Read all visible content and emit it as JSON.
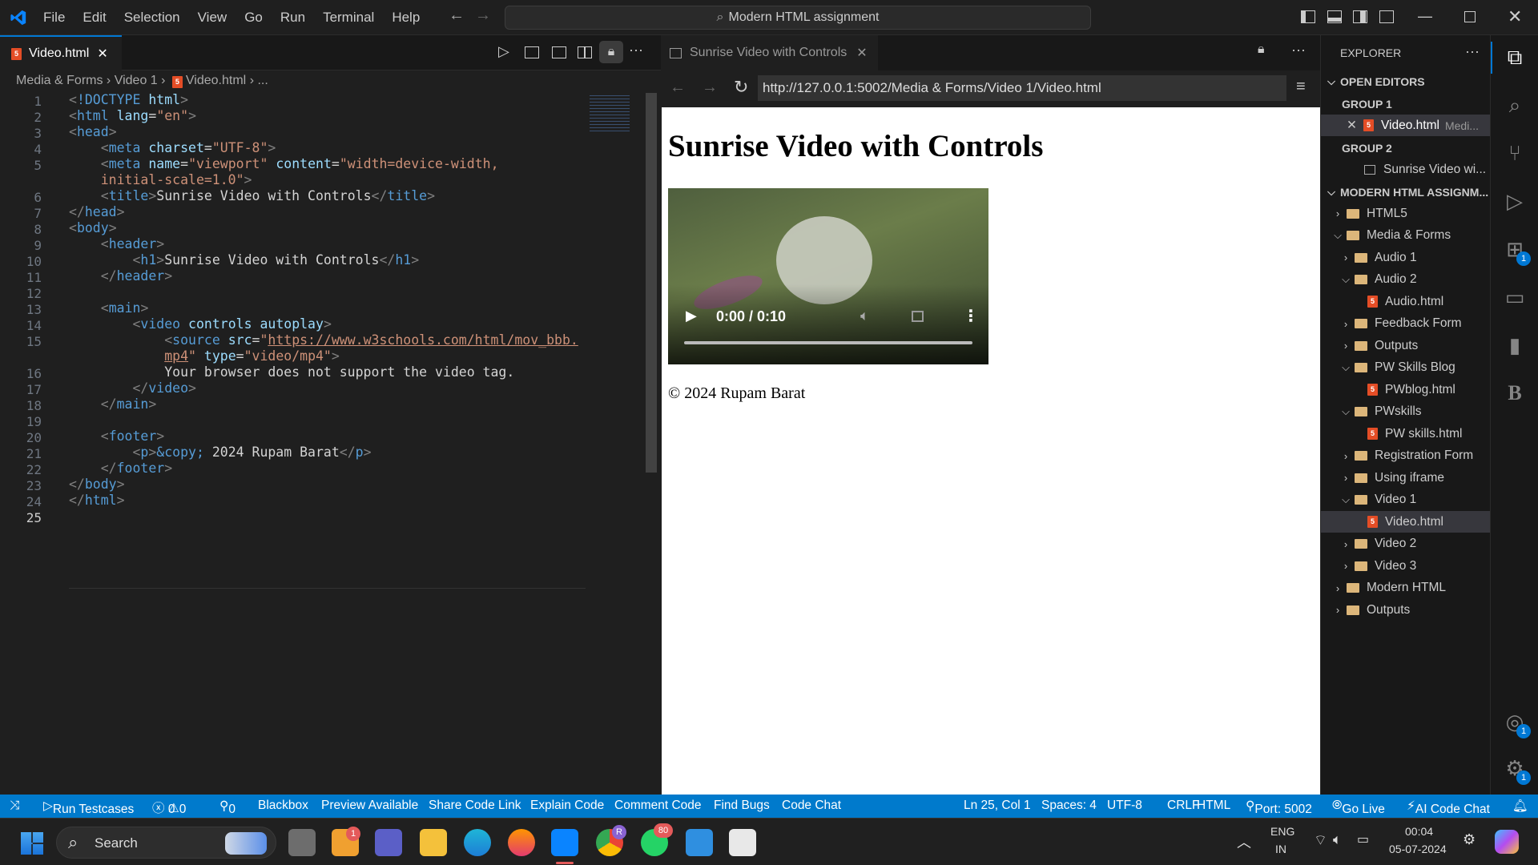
{
  "titlebar": {
    "menu": [
      "File",
      "Edit",
      "Selection",
      "View",
      "Go",
      "Run",
      "Terminal",
      "Help"
    ],
    "command_center": "Modern HTML assignment"
  },
  "editor": {
    "tab_label": "Video.html",
    "breadcrumb": [
      "Media & Forms",
      "Video 1",
      "Video.html",
      "..."
    ],
    "line_numbers": [
      "1",
      "2",
      "3",
      "4",
      "5",
      "",
      "6",
      "7",
      "8",
      "9",
      "10",
      "11",
      "12",
      "13",
      "14",
      "15",
      "",
      "16",
      "17",
      "18",
      "19",
      "20",
      "21",
      "22",
      "23",
      "24",
      "25"
    ]
  },
  "preview": {
    "tab_label": "Sunrise Video with Controls",
    "url": "http://127.0.0.1:5002/Media & Forms/Video 1/Video.html",
    "heading": "Sunrise Video with Controls",
    "video_time": "0:00 / 0:10",
    "footer": "© 2024 Rupam Barat"
  },
  "sidebar": {
    "title": "EXPLORER",
    "open_editors": "OPEN EDITORS",
    "group1": "GROUP 1",
    "group1_file": "Video.html",
    "group1_path": "Medi...",
    "group2": "GROUP 2",
    "group2_file": "Sunrise Video wi...",
    "project": "MODERN HTML ASSIGNM...",
    "tree": [
      {
        "label": "HTML5",
        "type": "folder",
        "depth": 0,
        "open": false
      },
      {
        "label": "Media & Forms",
        "type": "folder",
        "depth": 0,
        "open": true
      },
      {
        "label": "Audio 1",
        "type": "folder",
        "depth": 1,
        "open": false
      },
      {
        "label": "Audio 2",
        "type": "folder",
        "depth": 1,
        "open": true
      },
      {
        "label": "Audio.html",
        "type": "file",
        "depth": 2
      },
      {
        "label": "Feedback Form",
        "type": "folder",
        "depth": 1,
        "open": false
      },
      {
        "label": "Outputs",
        "type": "folder",
        "depth": 1,
        "open": false
      },
      {
        "label": "PW Skills Blog",
        "type": "folder",
        "depth": 1,
        "open": true
      },
      {
        "label": "PWblog.html",
        "type": "file",
        "depth": 2
      },
      {
        "label": "PWskills",
        "type": "folder",
        "depth": 1,
        "open": true
      },
      {
        "label": "PW skills.html",
        "type": "file",
        "depth": 2
      },
      {
        "label": "Registration Form",
        "type": "folder",
        "depth": 1,
        "open": false
      },
      {
        "label": "Using iframe",
        "type": "folder",
        "depth": 1,
        "open": false
      },
      {
        "label": "Video 1",
        "type": "folder",
        "depth": 1,
        "open": true
      },
      {
        "label": "Video.html",
        "type": "file",
        "depth": 2,
        "selected": true
      },
      {
        "label": "Video 2",
        "type": "folder",
        "depth": 1,
        "open": false
      },
      {
        "label": "Video 3",
        "type": "folder",
        "depth": 1,
        "open": false
      },
      {
        "label": "Modern HTML",
        "type": "folder",
        "depth": 0,
        "open": false
      },
      {
        "label": "Outputs",
        "type": "folder",
        "depth": 0,
        "open": false
      }
    ]
  },
  "activity_badges": {
    "extensions": "1",
    "accounts": "1",
    "settings": "1"
  },
  "statusbar": {
    "run_testcases": "Run Testcases",
    "errors": "0",
    "warnings": "0",
    "ports": "0",
    "items": [
      "Blackbox",
      "Preview Available",
      "Share Code Link",
      "Explain Code",
      "Comment Code",
      "Find Bugs",
      "Code Chat"
    ],
    "position": "Ln 25, Col 1",
    "spaces": "Spaces: 4",
    "encoding": "UTF-8",
    "eol": "CRLF",
    "language": "HTML",
    "port": "Port: 5002",
    "go_live": "Go Live",
    "ai_chat": "AI Code Chat"
  },
  "taskbar": {
    "search": "Search",
    "lang1": "ENG",
    "lang2": "IN",
    "time": "00:04",
    "date": "05-07-2024",
    "badge_tasks": "1",
    "badge_whatsapp": "80",
    "chrome_avatar": "R"
  },
  "colors": {
    "accent": "#0078d4",
    "status": "#007acc",
    "html_icon": "#e44d26",
    "folder": "#dcb67a"
  }
}
